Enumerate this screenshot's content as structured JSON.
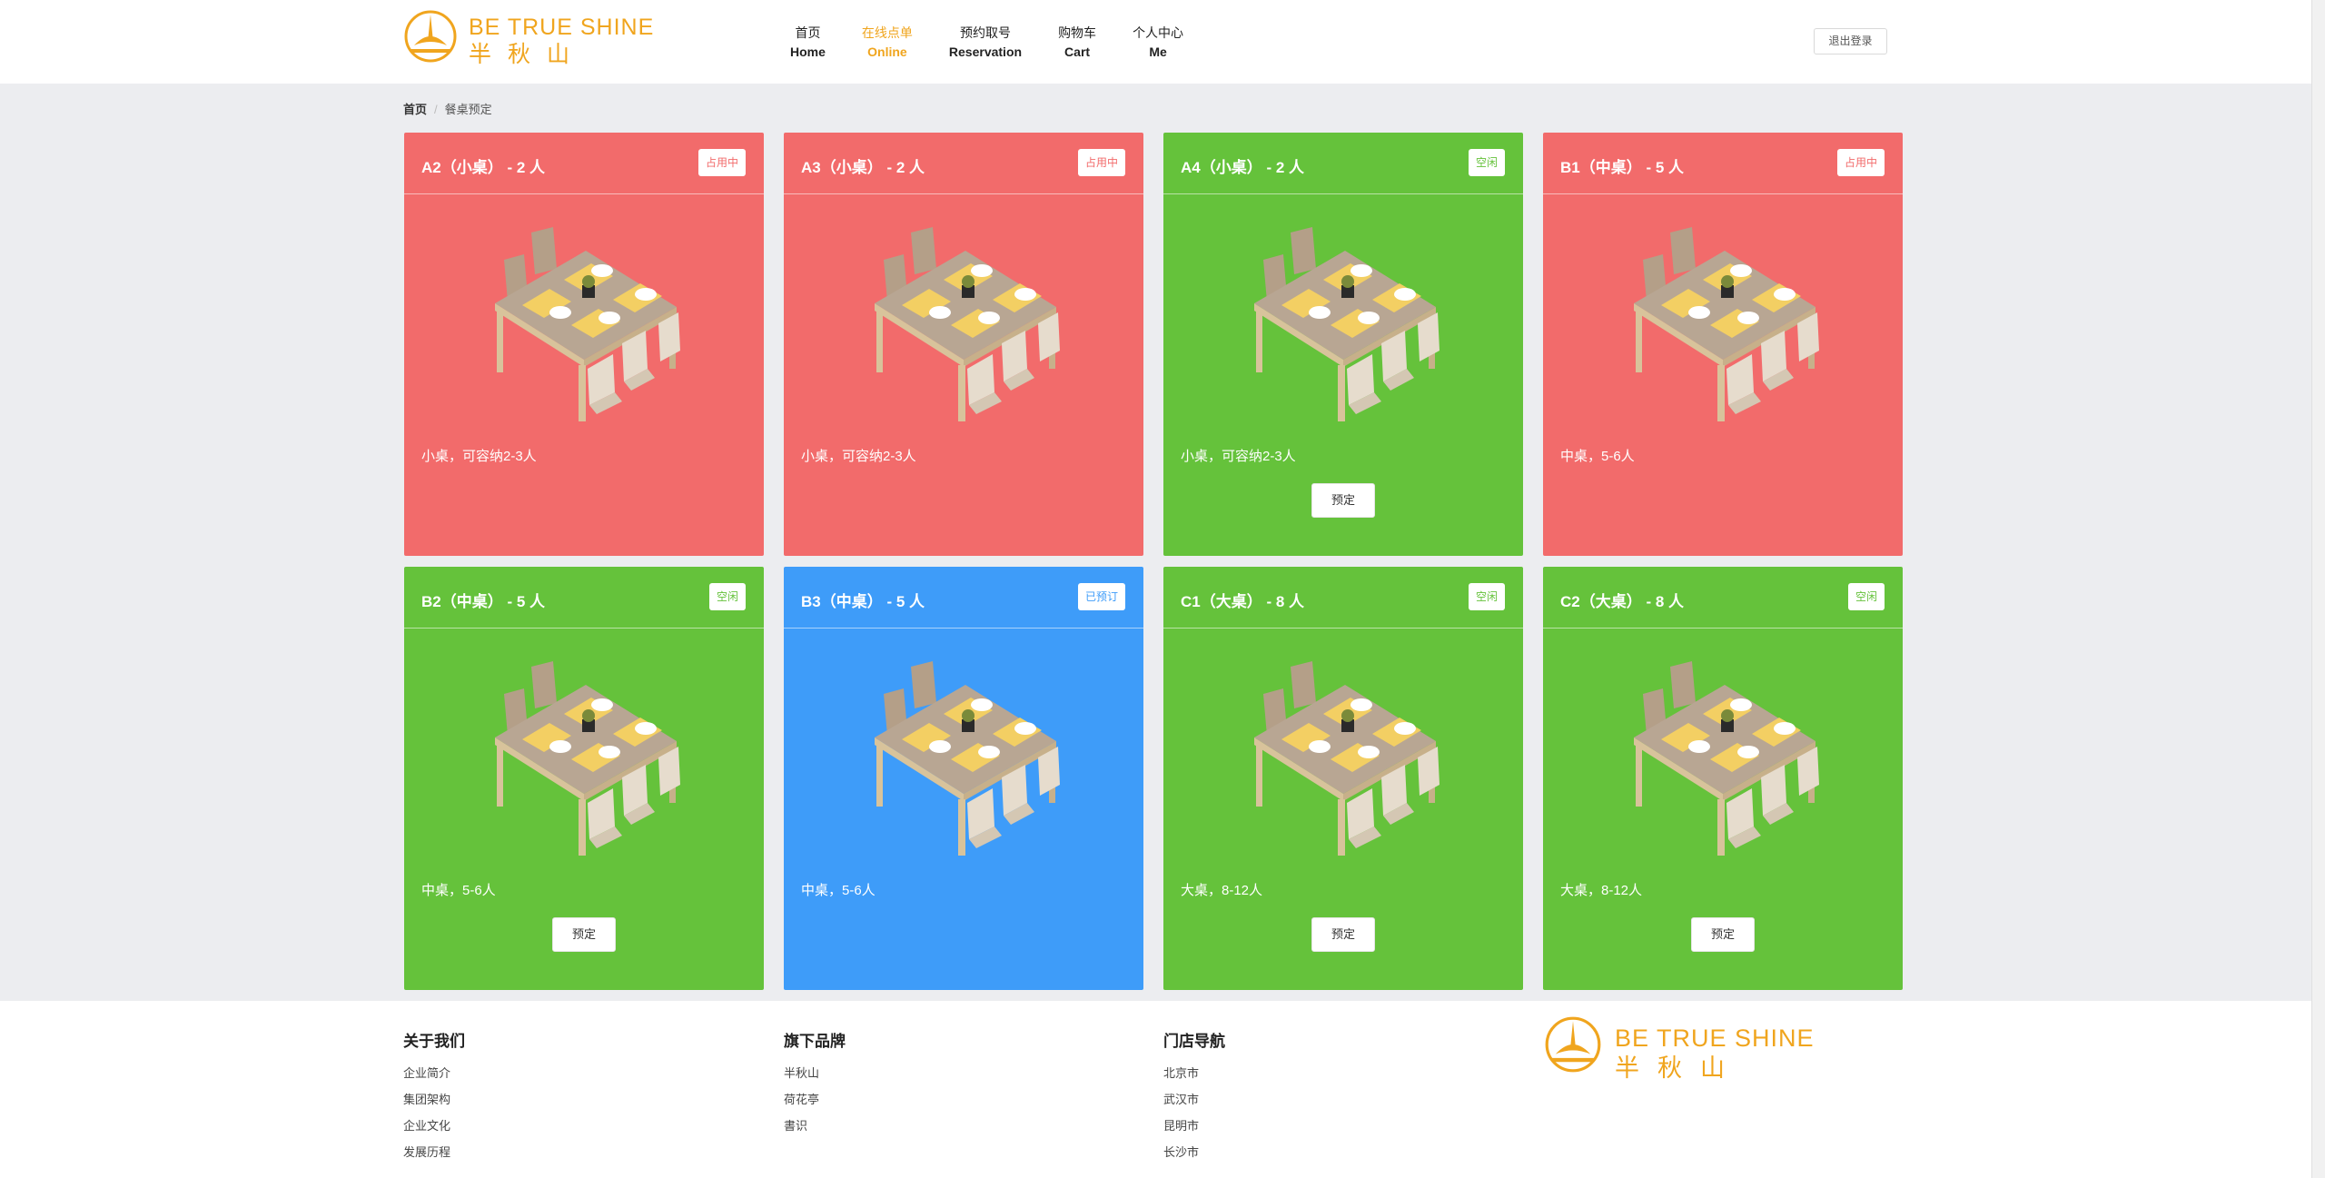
{
  "brand": {
    "name_en": "BE TRUE SHINE",
    "name_zh": "半秋山",
    "color": "#f0a51e"
  },
  "nav": [
    {
      "zh": "首页",
      "en": "Home",
      "active": false
    },
    {
      "zh": "在线点单",
      "en": "Online",
      "active": true
    },
    {
      "zh": "预约取号",
      "en": "Reservation",
      "active": false
    },
    {
      "zh": "购物车",
      "en": "Cart",
      "active": false
    },
    {
      "zh": "个人中心",
      "en": "Me",
      "active": false
    }
  ],
  "logout_label": "退出登录",
  "breadcrumb": {
    "home": "首页",
    "sep": "/",
    "current": "餐桌预定"
  },
  "colors": {
    "occupied": "#f26b6b",
    "free": "#65c23b",
    "reserved": "#3e9cf9"
  },
  "tables": [
    {
      "title": "A2（小桌） - 2 人",
      "status": "occupied",
      "badge": "占用中",
      "desc": "小桌，可容纳2-3人",
      "button": ""
    },
    {
      "title": "A3（小桌） - 2 人",
      "status": "occupied",
      "badge": "占用中",
      "desc": "小桌，可容纳2-3人",
      "button": ""
    },
    {
      "title": "A4（小桌） - 2 人",
      "status": "free",
      "badge": "空闲",
      "desc": "小桌，可容纳2-3人",
      "button": "预定"
    },
    {
      "title": "B1（中桌） - 5 人",
      "status": "occupied",
      "badge": "占用中",
      "desc": "中桌，5-6人",
      "button": ""
    },
    {
      "title": "B2（中桌） - 5 人",
      "status": "free",
      "badge": "空闲",
      "desc": "中桌，5-6人",
      "button": "预定"
    },
    {
      "title": "B3（中桌） - 5 人",
      "status": "reserved",
      "badge": "已预订",
      "desc": "中桌，5-6人",
      "button": ""
    },
    {
      "title": "C1（大桌） - 8 人",
      "status": "free",
      "badge": "空闲",
      "desc": "大桌，8-12人",
      "button": "预定"
    },
    {
      "title": "C2（大桌） - 8 人",
      "status": "free",
      "badge": "空闲",
      "desc": "大桌，8-12人",
      "button": "预定"
    }
  ],
  "footer": {
    "columns": [
      {
        "title": "关于我们",
        "links": [
          "企业简介",
          "集团架构",
          "企业文化",
          "发展历程"
        ]
      },
      {
        "title": "旗下品牌",
        "links": [
          "半秋山",
          "荷花亭",
          "書识"
        ]
      },
      {
        "title": "门店导航",
        "links": [
          "北京市",
          "武汉市",
          "昆明市",
          "长沙市"
        ]
      }
    ]
  }
}
